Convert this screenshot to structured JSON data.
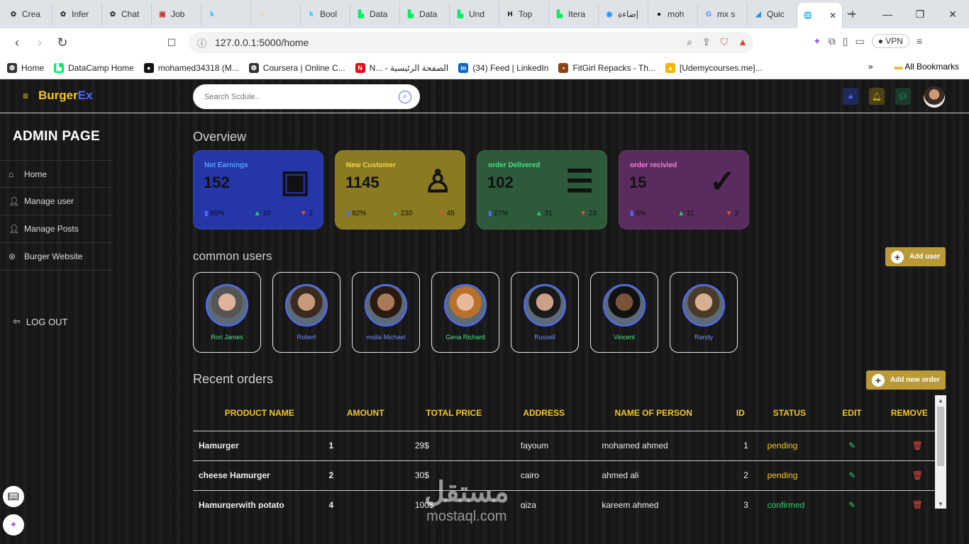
{
  "browser": {
    "tabs": [
      {
        "label": "Crea",
        "icon": "openai-icon",
        "color": "#333333"
      },
      {
        "label": "Infer",
        "icon": "openai-icon",
        "color": "#333333"
      },
      {
        "label": "Chat",
        "icon": "openai-icon",
        "color": "#333333"
      },
      {
        "label": "Job",
        "icon": "job-icon",
        "color": "#c0392b"
      },
      {
        "label": "",
        "icon": "kaggle-icon",
        "color": "#20beff"
      },
      {
        "label": "",
        "icon": "emoji-icon",
        "color": "#f3c623"
      },
      {
        "label": "Bool",
        "icon": "kaggle-icon",
        "color": "#20beff"
      },
      {
        "label": "Data",
        "icon": "datacamp-icon",
        "color": "#03ef62"
      },
      {
        "label": "Data",
        "icon": "datacamp-icon",
        "color": "#03ef62"
      },
      {
        "label": "Und",
        "icon": "datacamp-icon",
        "color": "#03ef62"
      },
      {
        "label": "Top",
        "icon": "hackernoon-icon",
        "color": "#111111"
      },
      {
        "label": "Itera",
        "icon": "datacamp-icon",
        "color": "#03ef62"
      },
      {
        "label": "إضاءة",
        "icon": "circle-icon",
        "color": "#1e90ff"
      },
      {
        "label": "moh",
        "icon": "github-icon",
        "color": "#111111"
      },
      {
        "label": "mx s",
        "icon": "google-icon",
        "color": "#4285f4"
      },
      {
        "label": "Quic",
        "icon": "flutter-icon",
        "color": "#2b8fd6"
      }
    ],
    "active_tab_icon": "globe-icon",
    "url": "127.0.0.1:5000/home",
    "vpn_label": "VPN",
    "bookmarks": [
      {
        "label": "Home",
        "icon": "globe-icon",
        "color": "#333333"
      },
      {
        "label": "DataCamp Home",
        "icon": "datacamp-icon",
        "color": "#03ef62"
      },
      {
        "label": "mohamed34318 (M...",
        "icon": "github-icon",
        "color": "#111111"
      },
      {
        "label": "Coursera | Online C...",
        "icon": "globe-icon",
        "color": "#333333"
      },
      {
        "label": "N... - الصفحة الرئيسية",
        "icon": "netflix-icon",
        "color": "#e50914"
      },
      {
        "label": "(34) Feed | LinkedIn",
        "icon": "linkedin-icon",
        "color": "#0a66c2"
      },
      {
        "label": "FitGirl Repacks - Th...",
        "icon": "fitgirl-icon",
        "color": "#8b4513"
      },
      {
        "label": "[Udemycourses.me]...",
        "icon": "drive-icon",
        "color": "#f4b400"
      }
    ],
    "all_bookmarks_label": "All Bookmarks"
  },
  "app": {
    "brand_part1": "BurgerEx",
    "search_placeholder": "Search Scdule..",
    "admin_title": "ADMIN PAGE",
    "sidebar": [
      {
        "label": "Home",
        "icon": "home-icon"
      },
      {
        "label": "Manage user",
        "icon": "user-icon"
      },
      {
        "label": "Manage Posts",
        "icon": "user-icon"
      },
      {
        "label": "Burger Website",
        "icon": "compass-icon"
      }
    ],
    "logout_label": "LOG OUT",
    "overview_title": "Overview",
    "cards": [
      {
        "title": "Net Earnings",
        "value": "152",
        "pct": "65%",
        "up": "10",
        "down": "2",
        "bg": "#2436a8",
        "title_color": "#4fa3ff",
        "icon": "money-icon"
      },
      {
        "title": "New Customer",
        "value": "1145",
        "pct": "82%",
        "up": "230",
        "down": "45",
        "bg": "#8a7a22",
        "title_color": "#f3d64b",
        "icon": "person-icon"
      },
      {
        "title": "order Delivered",
        "value": "102",
        "pct": "27%",
        "up": "31",
        "down": "23",
        "bg": "#2c5a3a",
        "title_color": "#4be08a",
        "icon": "burger-icon"
      },
      {
        "title": "order recivied",
        "value": "15",
        "pct": "6%",
        "up": "11",
        "down": "2",
        "bg": "#5a2b5e",
        "title_color": "#ff7ae0",
        "icon": "check-icon"
      }
    ],
    "common_users_title": "common users",
    "add_user_label": "Add user",
    "users": [
      {
        "name": "Rori James",
        "color": "#4be08a"
      },
      {
        "name": "Robert",
        "color": "#6b8cff"
      },
      {
        "name": "molia Michael",
        "color": "#6b8cff"
      },
      {
        "name": "Gena Richard",
        "color": "#4be08a"
      },
      {
        "name": "Russell",
        "color": "#6b8cff"
      },
      {
        "name": "Vincent",
        "color": "#4be08a"
      },
      {
        "name": "Randy",
        "color": "#6b8cff"
      }
    ],
    "recent_orders_title": "Recent orders",
    "add_order_label": "Add new order",
    "table": {
      "headers": [
        "PRODUCT NAME",
        "AMOUNT",
        "TOTAL PRICE",
        "ADDRESS",
        "NAME OF PERSON",
        "ID",
        "STATUS",
        "EDIT",
        "REMOVE"
      ],
      "rows": [
        {
          "product": "Hamurger",
          "amount": "1",
          "price": "29$",
          "address": "fayoum",
          "person": "mohamed ahmed",
          "id": "1",
          "status": "pending"
        },
        {
          "product": "cheese Hamurger",
          "amount": "2",
          "price": "30$",
          "address": "cairo",
          "person": "ahmed ali",
          "id": "2",
          "status": "pending"
        },
        {
          "product": "Hamurgerwith potato",
          "amount": "4",
          "price": "100$",
          "address": "giza",
          "person": "kareem ahmed",
          "id": "3",
          "status": "confirmed"
        }
      ]
    },
    "watermark_ar": "مستقل",
    "watermark_en": "mostaql.com"
  }
}
